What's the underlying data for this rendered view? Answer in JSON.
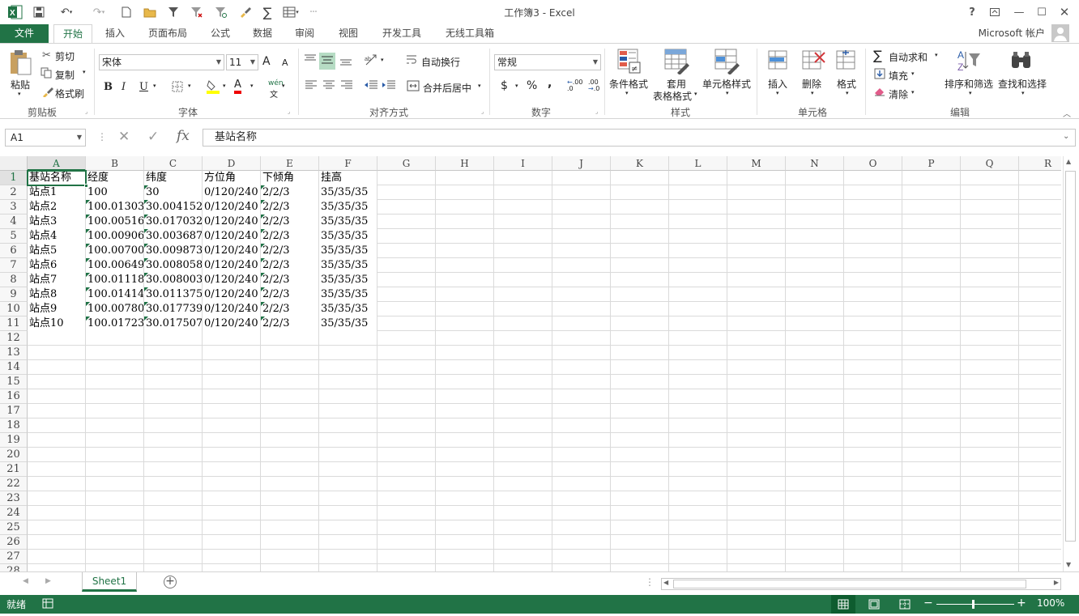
{
  "window": {
    "title": "工作簿3 - Excel"
  },
  "quick_access": {
    "save_icon": "save-icon",
    "undo_icon": "undo-icon",
    "redo_icon": "redo-icon"
  },
  "account": {
    "label": "Microsoft 帐户"
  },
  "tabs": [
    {
      "label": "文件"
    },
    {
      "label": "开始"
    },
    {
      "label": "插入"
    },
    {
      "label": "页面布局"
    },
    {
      "label": "公式"
    },
    {
      "label": "数据"
    },
    {
      "label": "审阅"
    },
    {
      "label": "视图"
    },
    {
      "label": "开发工具"
    },
    {
      "label": "无线工具箱"
    }
  ],
  "ribbon": {
    "clipboard": {
      "label": "剪贴板",
      "paste": "粘贴",
      "cut": "剪切",
      "copy": "复制",
      "format_painter": "格式刷"
    },
    "font": {
      "label": "字体",
      "font_name": "宋体",
      "font_size": "11",
      "bold": "B",
      "italic": "I",
      "underline": "U",
      "grow": "A",
      "shrink": "A",
      "font_color": "A",
      "phonetic": "wén"
    },
    "alignment": {
      "label": "对齐方式",
      "wrap": "自动换行",
      "merge": "合并后居中"
    },
    "number": {
      "label": "数字",
      "format": "常规",
      "currency": "$",
      "percent": "%",
      "comma": ",",
      "inc_decimal": ".00",
      "dec_decimal": ".00"
    },
    "styles": {
      "label": "样式",
      "conditional": "条件格式",
      "table1": "套用",
      "table2": "表格格式",
      "cell_styles": "单元格样式"
    },
    "cells": {
      "label": "单元格",
      "insert": "插入",
      "delete": "删除",
      "format": "格式"
    },
    "editing": {
      "label": "编辑",
      "autosum": "自动求和",
      "fill": "填充",
      "clear": "清除",
      "sort": "排序和筛选",
      "find": "查找和选择"
    }
  },
  "formula_bar": {
    "name_box": "A1",
    "fx": "fx",
    "formula": "基站名称"
  },
  "columns": [
    "A",
    "B",
    "C",
    "D",
    "E",
    "F",
    "G",
    "H",
    "I",
    "J",
    "K",
    "L",
    "M",
    "N",
    "O",
    "P",
    "Q",
    "R"
  ],
  "rows": [
    "1",
    "2",
    "3",
    "4",
    "5",
    "6",
    "7",
    "8",
    "9",
    "10",
    "11",
    "12",
    "13",
    "14",
    "15",
    "16",
    "17",
    "18",
    "19",
    "20",
    "21",
    "22",
    "23",
    "24",
    "25",
    "26",
    "27",
    "28"
  ],
  "cells": [
    [
      "基站名称",
      "经度",
      "纬度",
      "方位角",
      "下倾角",
      "挂高"
    ],
    [
      "站点1",
      "100",
      "30",
      "0/120/240",
      "2/2/3",
      "35/35/35"
    ],
    [
      "站点2",
      "100.013030",
      "30.004152",
      "0/120/240",
      "2/2/3",
      "35/35/35"
    ],
    [
      "站点3",
      "100.005160",
      "30.017032",
      "0/120/240",
      "2/2/3",
      "35/35/35"
    ],
    [
      "站点4",
      "100.009060",
      "30.003687",
      "0/120/240",
      "2/2/3",
      "35/35/35"
    ],
    [
      "站点5",
      "100.007000",
      "30.009873",
      "0/120/240",
      "2/2/3",
      "35/35/35"
    ],
    [
      "站点6",
      "100.006490",
      "30.008058",
      "0/120/240",
      "2/2/3",
      "35/35/35"
    ],
    [
      "站点7",
      "100.011180",
      "30.008003",
      "0/120/240",
      "2/2/3",
      "35/35/35"
    ],
    [
      "站点8",
      "100.014140",
      "30.011375",
      "0/120/240",
      "2/2/3",
      "35/35/35"
    ],
    [
      "站点9",
      "100.007800",
      "30.017739",
      "0/120/240",
      "2/2/3",
      "35/35/35"
    ],
    [
      "站点10",
      "100.017230",
      "30.017507",
      "0/120/240",
      "2/2/3",
      "35/35/35"
    ]
  ],
  "sheets": [
    {
      "label": "Sheet1"
    }
  ],
  "status": {
    "ready": "就绪",
    "zoom": "100%"
  },
  "colors": {
    "accent": "#217346"
  }
}
